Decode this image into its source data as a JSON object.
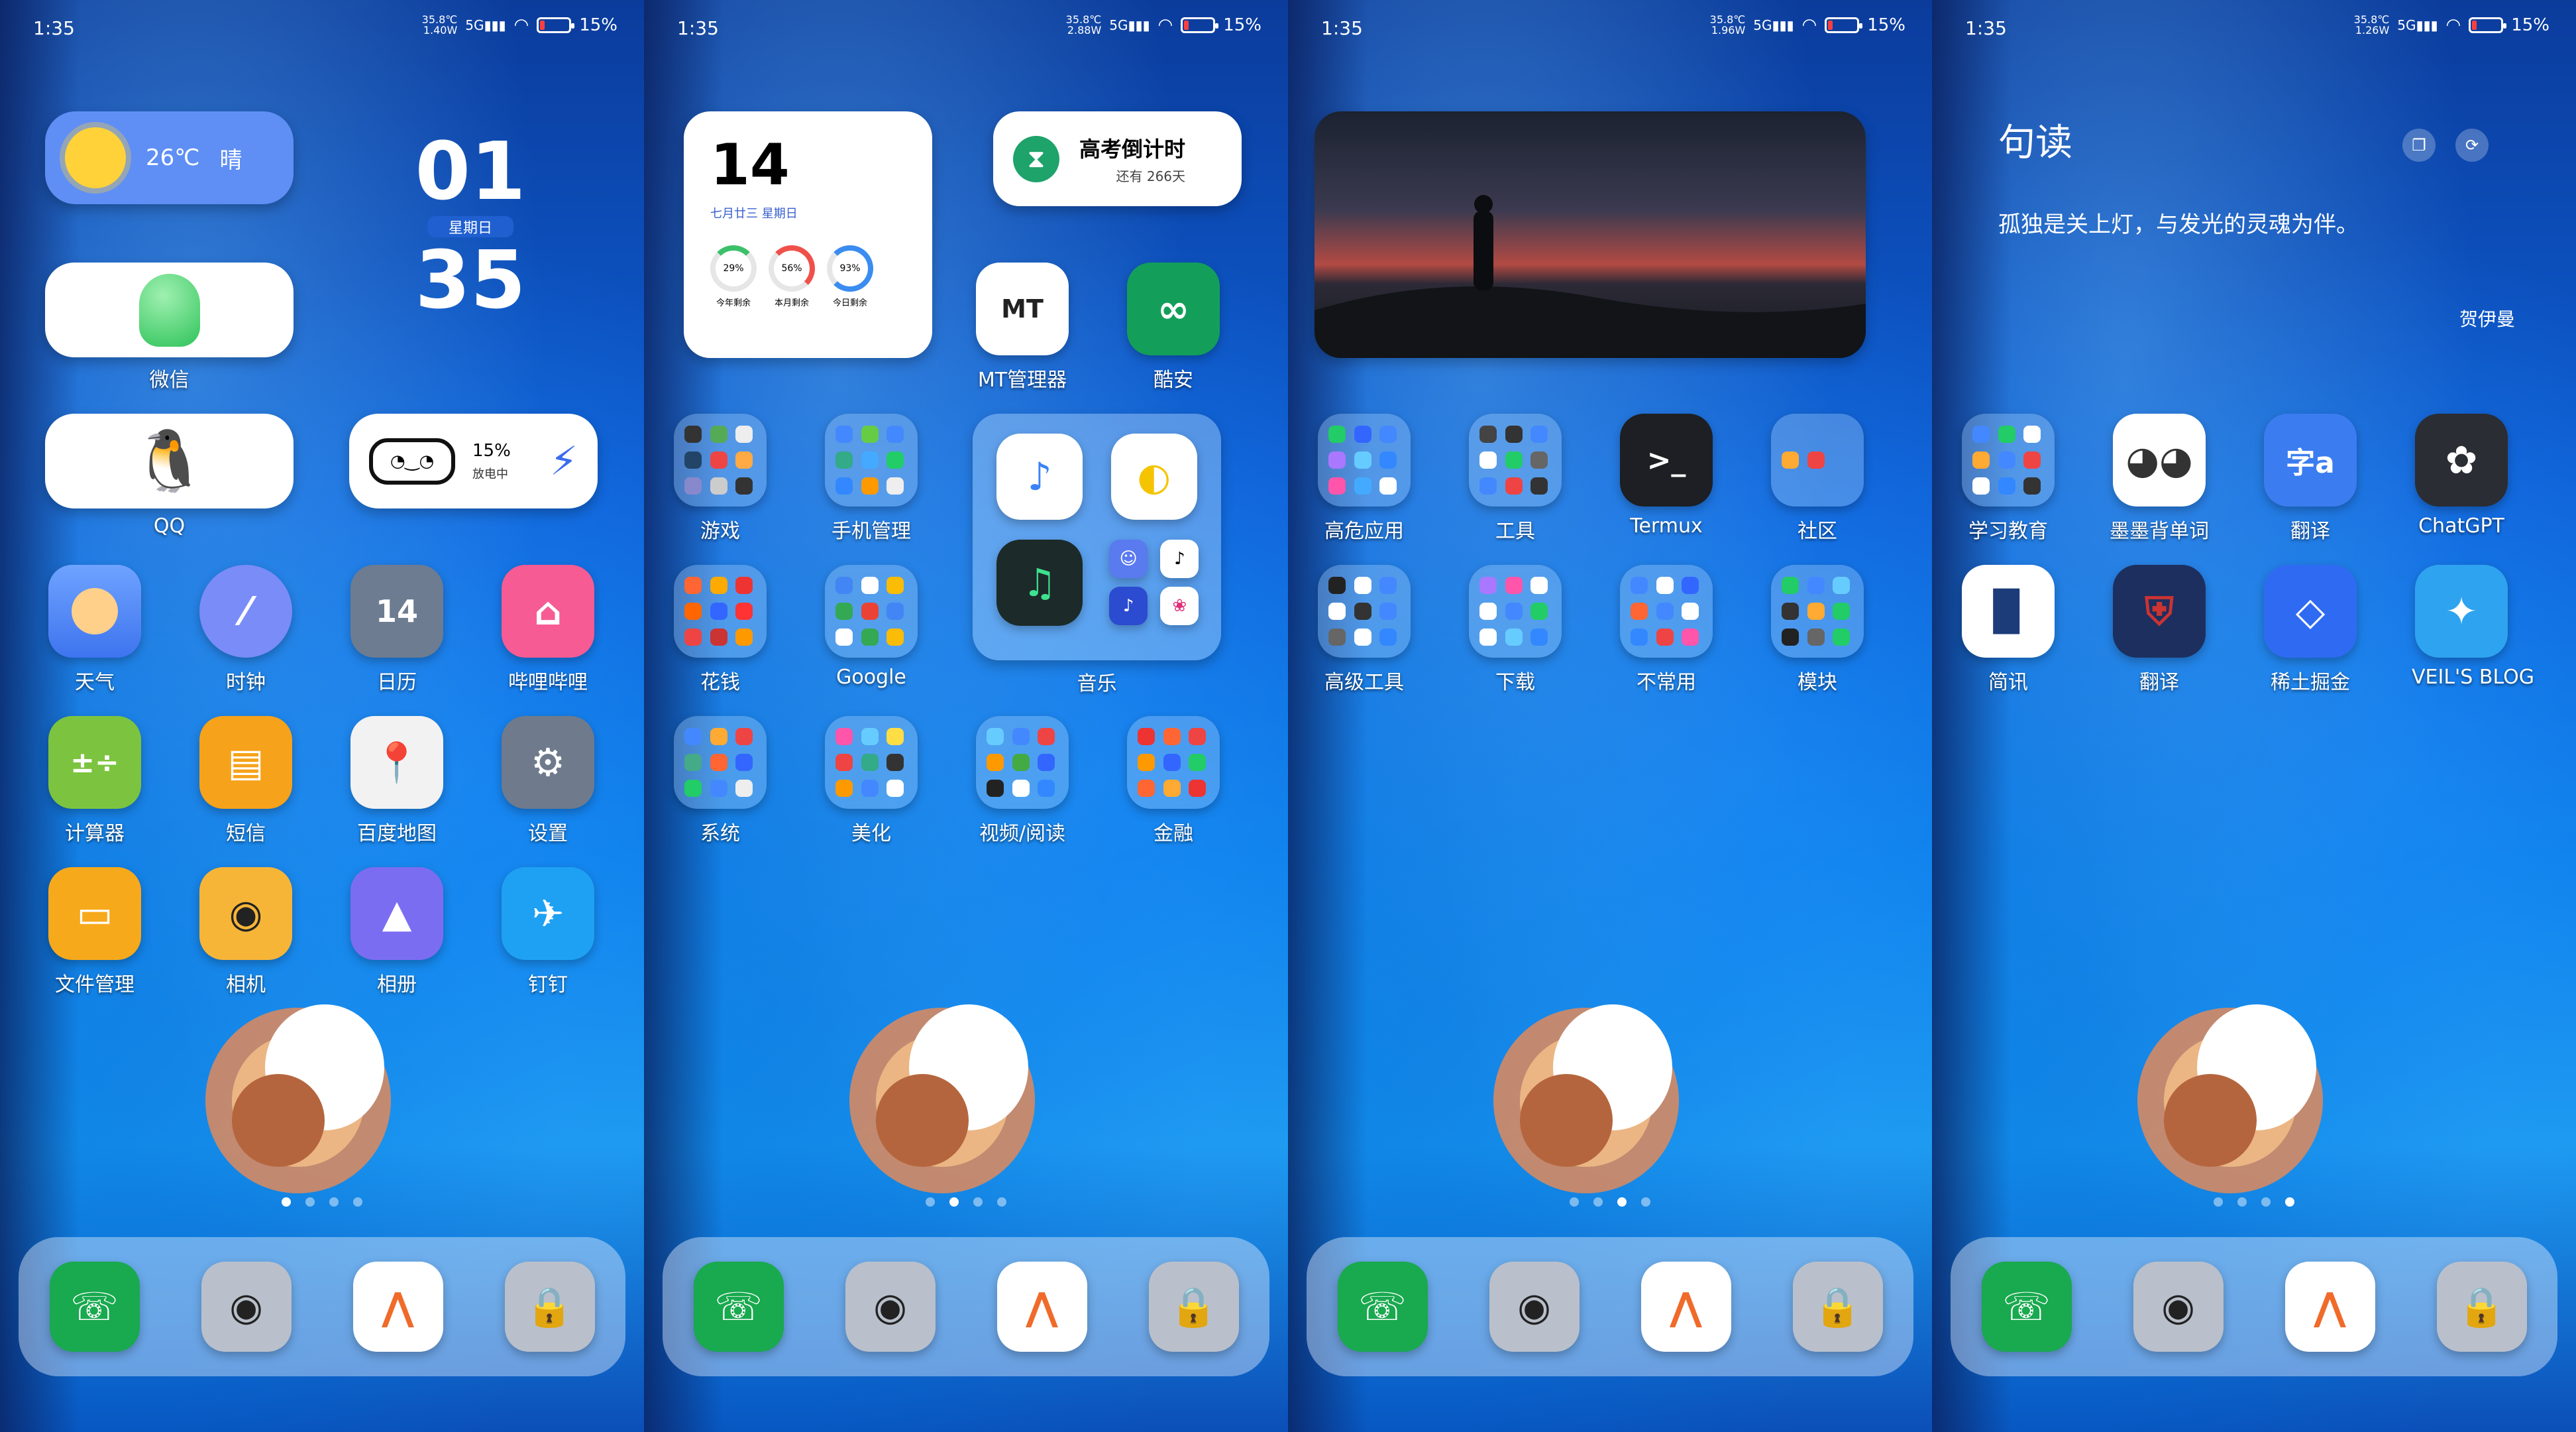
{
  "status": {
    "time": "1:35",
    "battery": "15%",
    "signal": "5G"
  },
  "screens": [
    {
      "netspeed": [
        "35.8℃",
        "1.40W"
      ],
      "weather": {
        "temp": "26℃",
        "cond": "晴"
      },
      "clock": {
        "hour": "01",
        "day": "星期日",
        "minute": "35"
      },
      "wechat_label": "微信",
      "qq_label": "QQ",
      "battery_widget": {
        "percent": "15%",
        "status": "放电中"
      },
      "apps": [
        {
          "label": "天气"
        },
        {
          "label": "时钟"
        },
        {
          "label": "日历",
          "text": "14"
        },
        {
          "label": "哔哩哔哩"
        },
        {
          "label": "计算器"
        },
        {
          "label": "短信"
        },
        {
          "label": "百度地图"
        },
        {
          "label": "设置"
        },
        {
          "label": "文件管理"
        },
        {
          "label": "相机"
        },
        {
          "label": "相册"
        },
        {
          "label": "钉钉"
        }
      ]
    },
    {
      "netspeed": [
        "35.8℃",
        "2.88W"
      ],
      "cal": {
        "date": "14",
        "lunar": "七月廿三 星期日",
        "rings": [
          {
            "pct": "29%",
            "label": "今年剩余"
          },
          {
            "pct": "56%",
            "label": "本月剩余"
          },
          {
            "pct": "93%",
            "label": "今日剩余"
          }
        ]
      },
      "countdown": {
        "title": "高考倒计时",
        "sub": "还有 266天"
      },
      "apps": [
        {
          "label": "MT管理器",
          "text": "MT"
        },
        {
          "label": "酷安"
        },
        {
          "label": "游戏"
        },
        {
          "label": "手机管理"
        },
        {
          "label": "花钱"
        },
        {
          "label": "Google"
        },
        {
          "label": "系统"
        },
        {
          "label": "美化"
        },
        {
          "label": "视频/阅读"
        },
        {
          "label": "金融"
        }
      ],
      "music_label": "音乐"
    },
    {
      "netspeed": [
        "35.8℃",
        "1.96W"
      ],
      "apps": [
        {
          "label": "高危应用"
        },
        {
          "label": "工具"
        },
        {
          "label": "Termux"
        },
        {
          "label": "社区"
        },
        {
          "label": "高级工具"
        },
        {
          "label": "下载"
        },
        {
          "label": "不常用"
        },
        {
          "label": "模块"
        }
      ]
    },
    {
      "netspeed": [
        "35.8℃",
        "1.26W"
      ],
      "quote": {
        "title": "句读",
        "text": "孤独是关上灯，与发光的灵魂为伴。",
        "author": "贺伊曼"
      },
      "apps": [
        {
          "label": "学习教育"
        },
        {
          "label": "墨墨背单词"
        },
        {
          "label": "翻译"
        },
        {
          "label": "ChatGPT"
        },
        {
          "label": "简讯"
        },
        {
          "label": "翻译"
        },
        {
          "label": "稀土掘金"
        },
        {
          "label": "VEIL'S BLOG"
        }
      ]
    }
  ],
  "dock": [
    {
      "name": "phone"
    },
    {
      "name": "camera"
    },
    {
      "name": "launcher"
    },
    {
      "name": "lock"
    }
  ]
}
